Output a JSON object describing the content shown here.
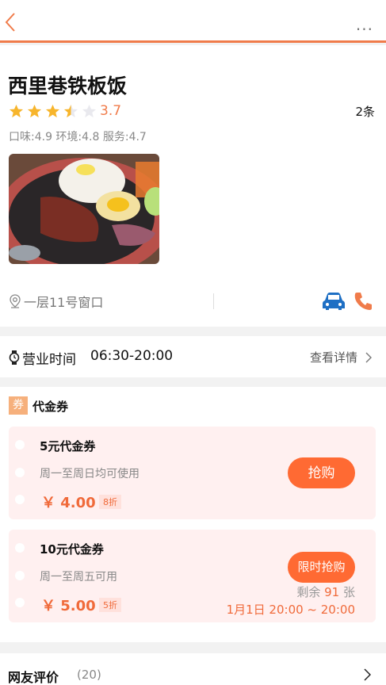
{
  "colors": {
    "accent": "#f07b4a",
    "price": "#f06a3a",
    "button": "#ff6a33",
    "star": "#f7b52c",
    "car": "#1e6fc4"
  },
  "header": {
    "back_icon": "chevron-left-icon",
    "more_label": "..."
  },
  "store": {
    "name": "西里巷铁板饭",
    "rating_value": 3.7,
    "rating": "3.7",
    "stars_filled": 3.5,
    "stars_total": 5,
    "review_count": "2条",
    "subscores": "口味:4.9 环境:4.8 服务:4.7",
    "location": "一层11号窗口"
  },
  "hours": {
    "label": "营业时间",
    "value": "06:30-20:00",
    "detail": "查看详情"
  },
  "vouchers": {
    "badge": "券",
    "title": "代金券",
    "items": [
      {
        "name": "5元代金券",
        "desc": "周一至周日均可使用",
        "price": "￥ 4.00",
        "discount": "8折",
        "button": "抢购"
      },
      {
        "name": "10元代金券",
        "desc": "周一至周五可用",
        "price": "￥ 5.00",
        "discount": "5折",
        "button": "限时抢购",
        "remain_prefix": "剩余",
        "remain_num": "91",
        "remain_suffix": "张",
        "period": "1月1日 20:00 ~ 20:00"
      }
    ]
  },
  "reviews": {
    "title": "网友评价",
    "count": "(20)"
  }
}
